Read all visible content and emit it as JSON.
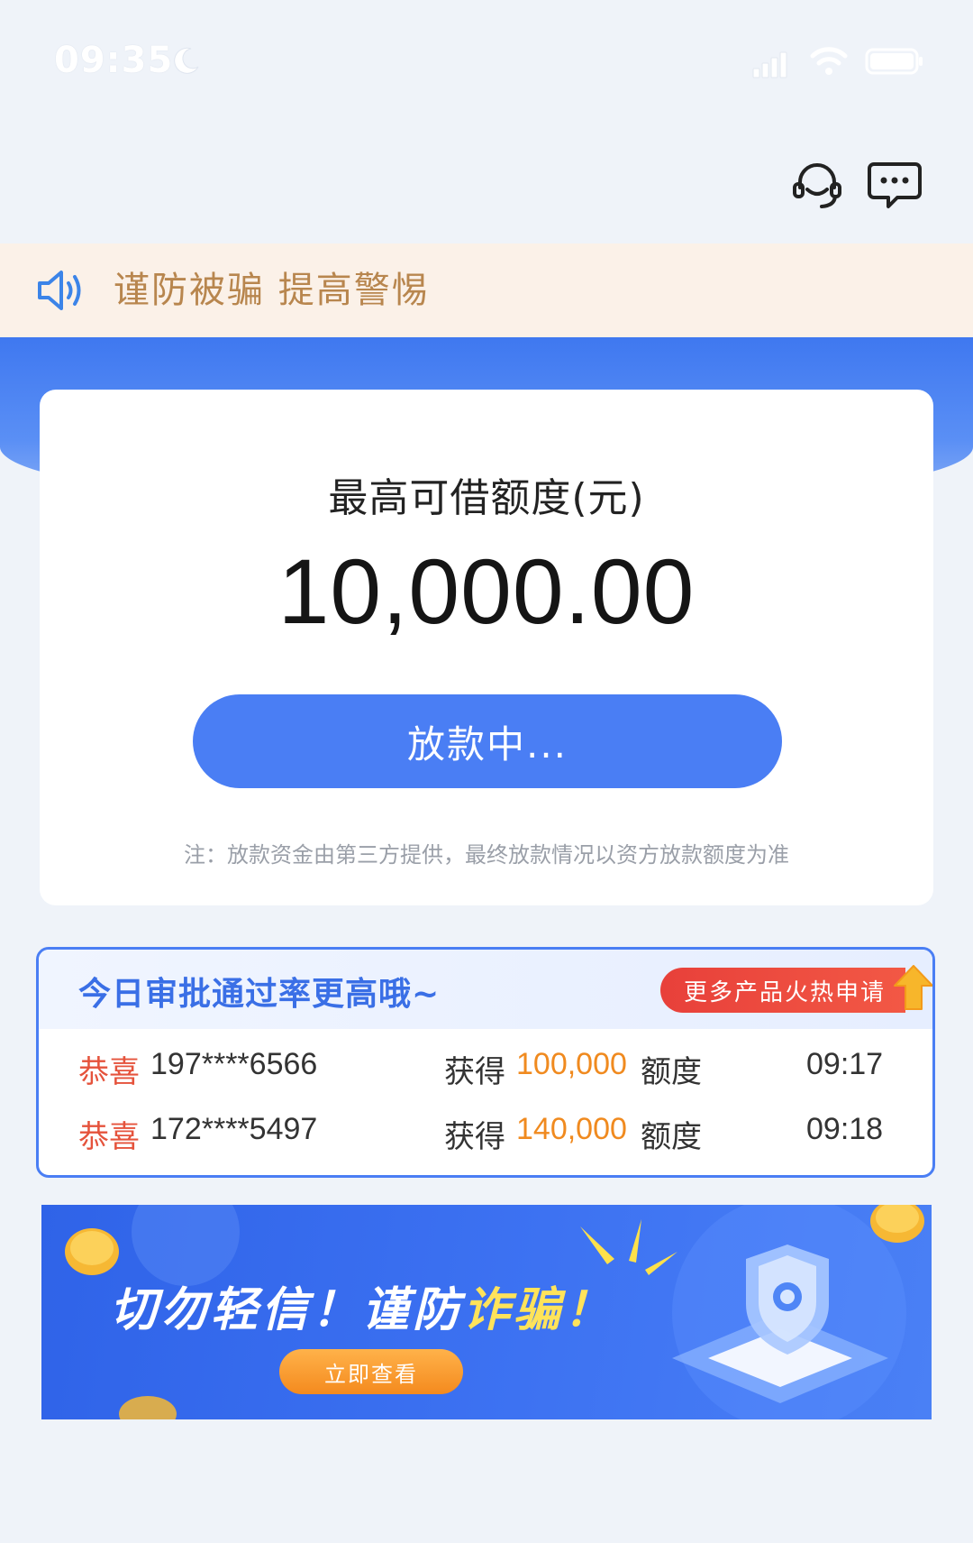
{
  "status_bar": {
    "time": "09:35"
  },
  "header": {
    "icons": [
      "customer-service-icon",
      "message-icon"
    ]
  },
  "notice": {
    "text": "谨防被骗 提高警惕"
  },
  "credit": {
    "title": "最高可借额度(元)",
    "amount": "10,000.00",
    "button_label": "放款中...",
    "note": "注：放款资金由第三方提供，最终放款情况以资方放款额度为准"
  },
  "approval": {
    "title": "今日审批通过率更高哦~",
    "badge": "更多产品火热申请",
    "rows": [
      {
        "congrats": "恭喜",
        "phone": "197****6566",
        "got": "获得",
        "amount": "100,000",
        "quota": "额度",
        "time": "09:17"
      },
      {
        "congrats": "恭喜",
        "phone": "172****5497",
        "got": "获得",
        "amount": "140,000",
        "quota": "额度",
        "time": "09:18"
      }
    ]
  },
  "banner": {
    "slogan_part1": "切勿轻信！谨防",
    "slogan_part2": "诈骗！",
    "button_label": "立即查看"
  },
  "colors": {
    "primary": "#4a7ef4",
    "notice_text": "#b8864e",
    "congrats": "#e5533c",
    "amount": "#f08a1f"
  }
}
